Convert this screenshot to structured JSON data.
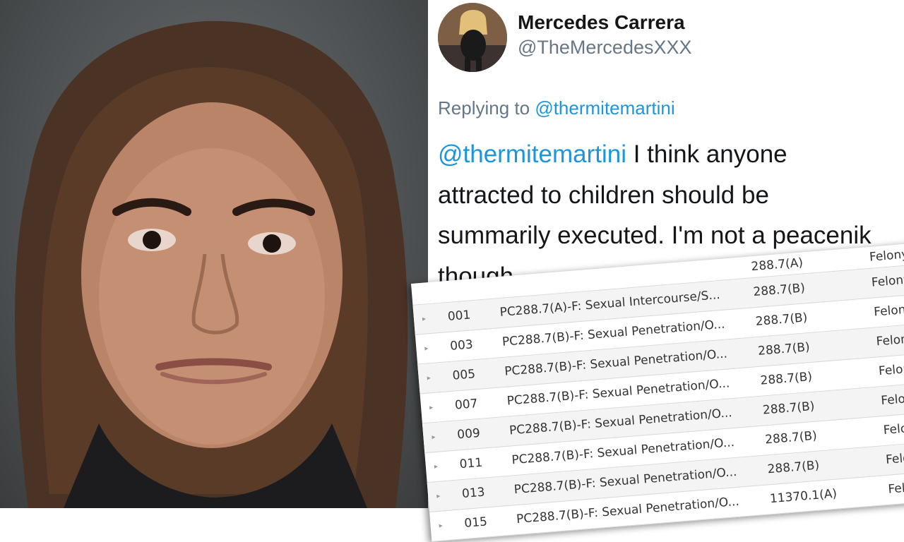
{
  "tweet": {
    "display_name": "Mercedes Carrera",
    "handle": "@TheMercedesXXX",
    "replying_prefix": "Replying to",
    "replying_to": "@thermitemartini",
    "body_mention": "@thermitemartini",
    "body_lines": [
      "I think anyone",
      "attracted to children should be",
      "summarily executed. I'm not a peacenik",
      "though."
    ]
  },
  "charges": {
    "header": {
      "code": "288.7(A)",
      "type": "Felony"
    },
    "rows": [
      {
        "arrow": "▸",
        "num": "001",
        "desc": "PC288.7(A)-F: Sexual Intercourse/S...",
        "code": "288.7(B)",
        "type": "Felony"
      },
      {
        "arrow": "▸",
        "num": "003",
        "desc": "PC288.7(B)-F: Sexual Penetration/O...",
        "code": "288.7(B)",
        "type": "Felony"
      },
      {
        "arrow": "▸",
        "num": "005",
        "desc": "PC288.7(B)-F: Sexual Penetration/O...",
        "code": "288.7(B)",
        "type": "Felony"
      },
      {
        "arrow": "▸",
        "num": "007",
        "desc": "PC288.7(B)-F: Sexual Penetration/O...",
        "code": "288.7(B)",
        "type": "Felony"
      },
      {
        "arrow": "▸",
        "num": "009",
        "desc": "PC288.7(B)-F: Sexual Penetration/O...",
        "code": "288.7(B)",
        "type": "Felony"
      },
      {
        "arrow": "▸",
        "num": "011",
        "desc": "PC288.7(B)-F: Sexual Penetration/O...",
        "code": "288.7(B)",
        "type": "Felony"
      },
      {
        "arrow": "▸",
        "num": "013",
        "desc": "PC288.7(B)-F: Sexual Penetration/O...",
        "code": "288.7(B)",
        "type": "Felony"
      },
      {
        "arrow": "▸",
        "num": "015",
        "desc": "PC288.7(B)-F: Sexual Penetration/O...",
        "code": "11370.1(A)",
        "type": "Felony"
      }
    ]
  },
  "colors": {
    "mention": "#1b95e0",
    "secondary_text": "#657786",
    "primary_text": "#14171a"
  }
}
